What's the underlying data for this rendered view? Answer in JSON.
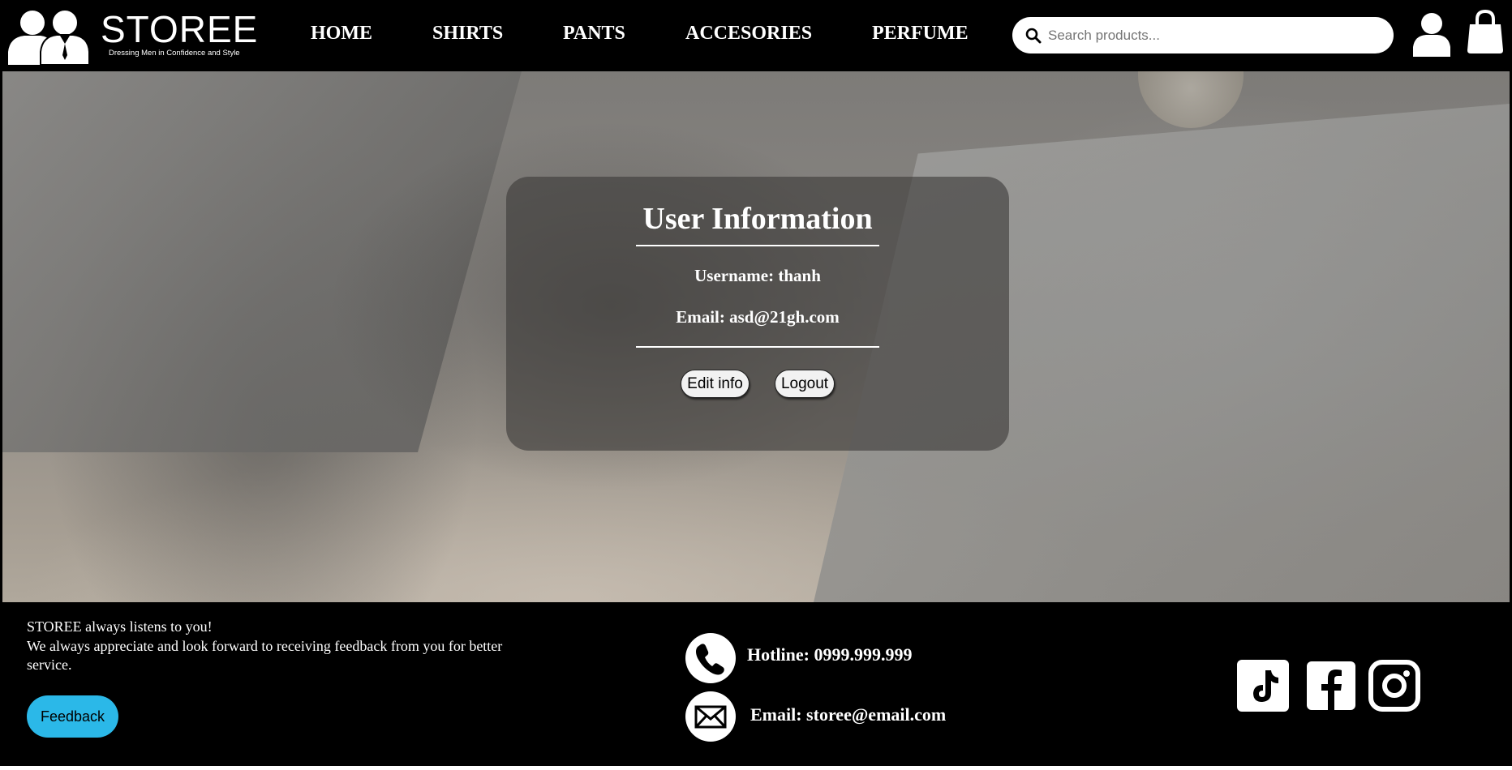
{
  "brand": {
    "name": "STOREE",
    "tagline": "Dressing Men in Confidence and Style"
  },
  "nav": {
    "items": [
      {
        "label": "HOME"
      },
      {
        "label": "SHIRTS"
      },
      {
        "label": "PANTS"
      },
      {
        "label": "ACCESORIES"
      },
      {
        "label": "PERFUME"
      }
    ]
  },
  "search": {
    "placeholder": "Search products...",
    "value": ""
  },
  "header_icons": {
    "search": "search-icon",
    "user": "user-icon",
    "cart": "shopping-bag-icon"
  },
  "user_card": {
    "title": "User Information",
    "username": "Username: thanh",
    "email": "Email: asd@21gh.com",
    "edit_label": "Edit info",
    "logout_label": "Logout"
  },
  "footer": {
    "line1": "STOREE always listens to you!",
    "line2": "We always appreciate and look forward to receiving feedback from you for better service.",
    "feedback_label": "Feedback",
    "hotline": "Hotline: 0999.999.999",
    "email": "Email: storee@email.com",
    "social": [
      "tiktok-icon",
      "facebook-icon",
      "instagram-icon"
    ]
  },
  "colors": {
    "header_bg": "#000000",
    "footer_bg": "#000000",
    "feedback_button": "#2bb8e8",
    "text_light": "#ffffff"
  }
}
